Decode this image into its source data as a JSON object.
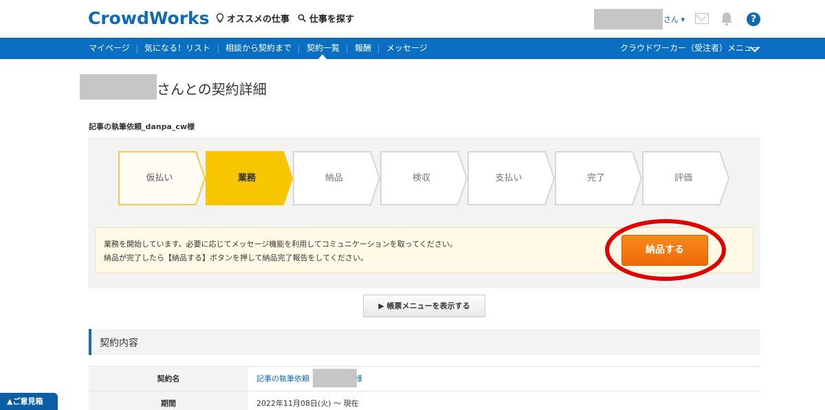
{
  "header": {
    "logo": "CrowdWorks",
    "nav_recommended": "オススメの仕事",
    "nav_find_job": "仕事を探す",
    "user_suffix": "さん ▾"
  },
  "navbar": {
    "items": [
      "マイページ",
      "気になる！リスト",
      "相談から契約まで",
      "契約一覧",
      "報酬",
      "メッセージ"
    ],
    "active": "契約一覧",
    "right_menu": "クラウドワーカー（受注者）メニュー"
  },
  "page": {
    "title": "さんとの契約詳細",
    "job_name": "記事の執筆依頼_danpa_cw様"
  },
  "steps": [
    {
      "label": "仮払い",
      "state": "done"
    },
    {
      "label": "業務",
      "state": "current"
    },
    {
      "label": "納品",
      "state": "todo"
    },
    {
      "label": "検収",
      "state": "todo"
    },
    {
      "label": "支払い",
      "state": "todo"
    },
    {
      "label": "完了",
      "state": "todo"
    },
    {
      "label": "評価",
      "state": "todo"
    }
  ],
  "notice": {
    "line1": "業務を開始しています。必要に応じてメッセージ機能を利用してコミュニケーションを取ってください。",
    "line2": "納品が完了したら【納品する】ボタンを押して納品完了報告をしてください。",
    "deliver_button": "納品する"
  },
  "ledger_button": "▶ 帳票メニューを表示する",
  "contract": {
    "section_title": "契約内容",
    "rows": [
      {
        "label": "契約名",
        "value_prefix": "記事の執筆依頼",
        "value_suffix": "様"
      },
      {
        "label": "期間",
        "value": "2022年11月08日(火) 〜 現在"
      }
    ]
  },
  "feedback": "▲ご意見箱",
  "colors": {
    "brand_blue": "#0b6fc1",
    "step_current": "#f7c600",
    "step_done_border": "#f2c94c",
    "deliver_orange": "#f07810",
    "annotation_red": "#e00000"
  }
}
